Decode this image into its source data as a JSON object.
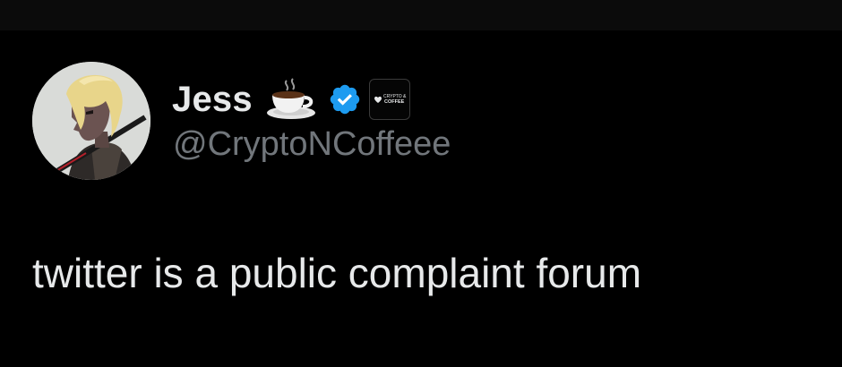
{
  "tweet": {
    "author": {
      "display_name": "Jess",
      "handle": "@CryptoNCoffeee",
      "name_emoji": "coffee-cup-icon",
      "verified": true,
      "affiliate_badge_text": [
        "CRYPTO &",
        "COFFEE"
      ]
    },
    "text": "twitter is a public complaint forum"
  },
  "colors": {
    "background": "#000000",
    "primary_text": "#e7e9ea",
    "secondary_text": "#71767b",
    "verified_blue": "#1d9bf0"
  }
}
